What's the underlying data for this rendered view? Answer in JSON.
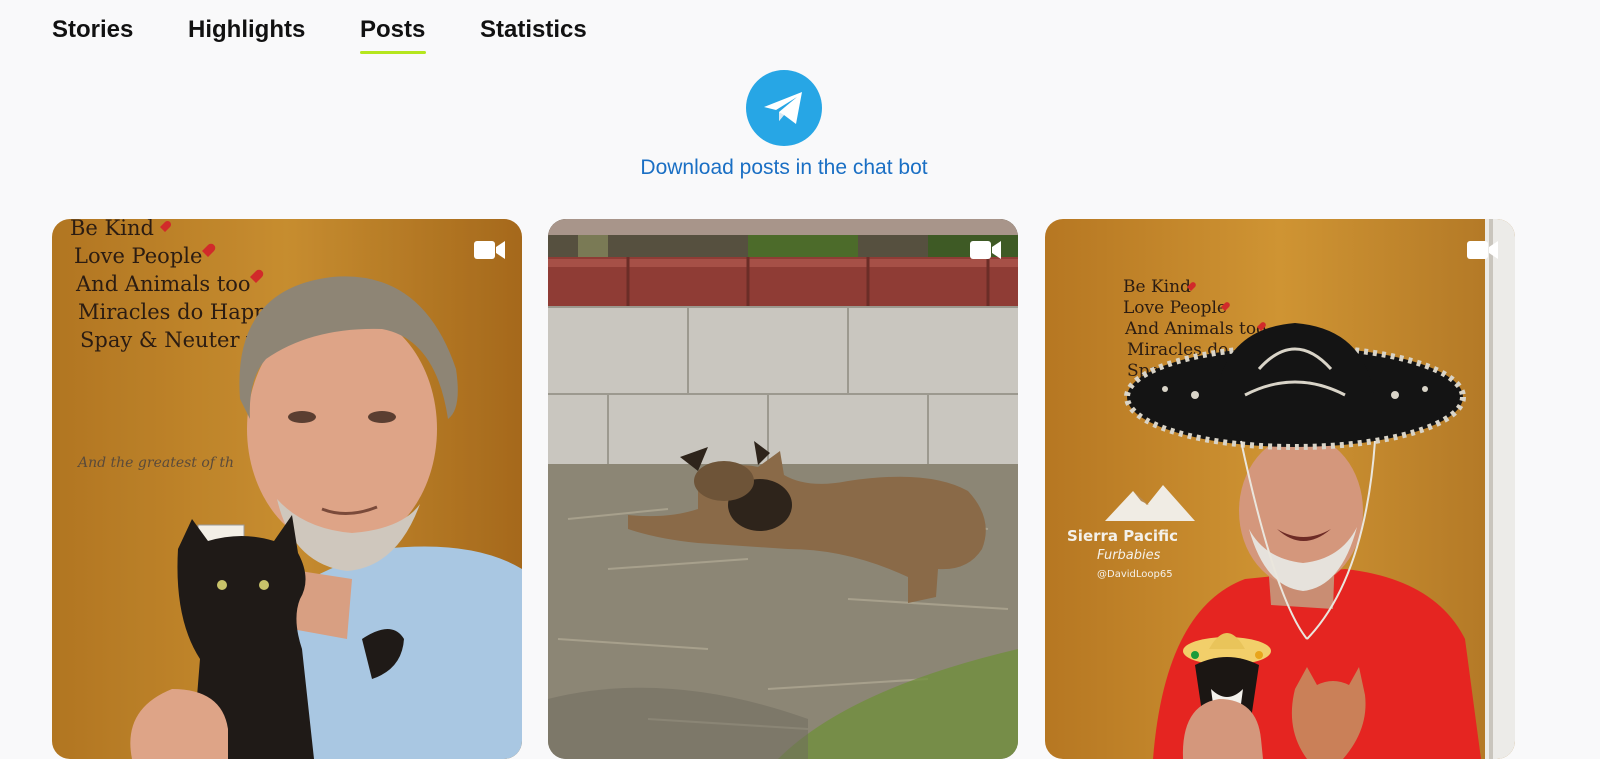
{
  "tabs": [
    {
      "label": "Stories"
    },
    {
      "label": "Highlights"
    },
    {
      "label": "Posts",
      "active": true
    },
    {
      "label": "Statistics"
    }
  ],
  "accent_color": "#b5e61d",
  "telegram": {
    "icon": "telegram-icon",
    "icon_color": "#27a6e5",
    "link_text": "Download posts in the chat bot",
    "link_color": "#1a6fc4"
  },
  "posts": [
    {
      "type": "video",
      "icon": "video-camera-icon",
      "sign_lines": [
        "Be Kind",
        "Love People",
        "And Animals too",
        "Miracles do Happe",
        "Spay & Neuter yo"
      ],
      "script_text": "And the greatest of th"
    },
    {
      "type": "video",
      "icon": "video-camera-icon"
    },
    {
      "type": "video",
      "icon": "video-camera-icon",
      "sign_lines": [
        "Be Kind",
        "Love People",
        "And Animals too",
        "Miracles do",
        "Spay & Ne"
      ],
      "logo_title": "Sierra Pacific",
      "logo_subtitle": "Furbabies",
      "logo_handle": "@DavidLoop65"
    }
  ]
}
